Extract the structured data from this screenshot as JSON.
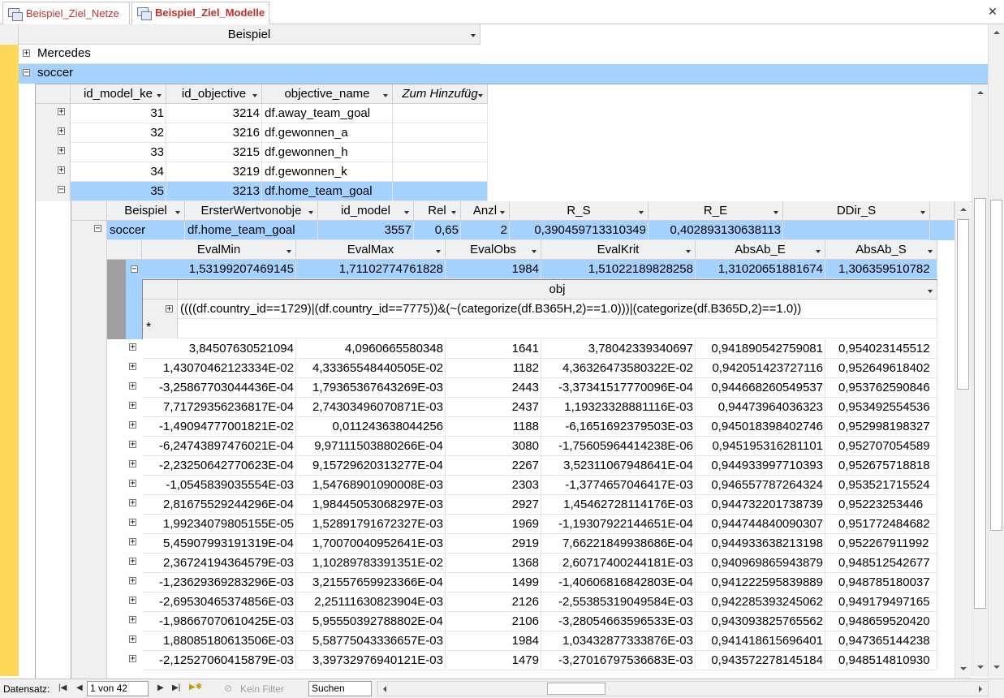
{
  "tabs": [
    {
      "label": "Beispiel_Ziel_Netze",
      "active": false
    },
    {
      "label": "Beispiel_Ziel_Modelle",
      "active": true
    }
  ],
  "close_glyph": "✕",
  "level1": {
    "header": "Beispiel",
    "rows": [
      "Mercedes",
      "soccer"
    ],
    "selected_row": "soccer"
  },
  "level2": {
    "headers": [
      "id_model_ke",
      "id_objective",
      "objective_name",
      "Zum Hinzufüg"
    ],
    "rows": [
      {
        "id_model": "31",
        "id_objective": "3214",
        "objective_name": "df.away_team_goal"
      },
      {
        "id_model": "32",
        "id_objective": "3216",
        "objective_name": "df.gewonnen_a"
      },
      {
        "id_model": "33",
        "id_objective": "3215",
        "objective_name": "df.gewonnen_h"
      },
      {
        "id_model": "34",
        "id_objective": "3219",
        "objective_name": "df.gewonnen_k"
      },
      {
        "id_model": "35",
        "id_objective": "3213",
        "objective_name": "df.home_team_goal"
      }
    ]
  },
  "level3": {
    "headers": [
      "Beispiel",
      "ErsterWertvonobje",
      "id_model",
      "Rel",
      "Anzl",
      "R_S",
      "R_E",
      "DDir_S"
    ],
    "row": {
      "Beispiel": "soccer",
      "ErsterWertvonobje": "df.home_team_goal",
      "id_model": "3557",
      "Rel": "0,65",
      "Anzl": "2",
      "R_S": "0,390459713310349",
      "R_E": "0,402893130638113",
      "DDir_S": ""
    }
  },
  "level4": {
    "headers": [
      "EvalMin",
      "EvalMax",
      "EvalObs",
      "EvalKrit",
      "AbsAb_E",
      "AbsAb_S"
    ],
    "first_row": [
      "1,53199207469145",
      "1,71102774761828",
      "1984",
      "1,51022189828258",
      "1,31020651881674",
      "1,306359510782"
    ],
    "obj_header": "obj",
    "obj_value": "((((df.country_id==1729)|(df.country_id==7775))&(~(categorize(df.B365H,2)==1.0)))|(categorize(df.B365D,2)==1.0))",
    "new_row_marker": "*",
    "rows": [
      [
        "3,84507630521094",
        "4,0960665580348",
        "1641",
        "3,78042339340697",
        "0,941890542759081",
        "0,954023145512"
      ],
      [
        "1,43070462123334E-02",
        "4,33365548440505E-02",
        "1182",
        "4,36326473580322E-02",
        "0,942051423727116",
        "0,952649618402"
      ],
      [
        "-3,25867703044436E-04",
        "1,79365367643269E-03",
        "2443",
        "-3,37341517770096E-04",
        "0,944668260549537",
        "0,953762590846"
      ],
      [
        "7,71729356236817E-04",
        "2,74303496070871E-03",
        "2437",
        "1,19323328881116E-03",
        "0,94473964036323",
        "0,953492554536"
      ],
      [
        "-1,49094777001821E-02",
        "0,011243638044256",
        "1188",
        "-6,1651692379503E-03",
        "0,945018398402746",
        "0,952998198327"
      ],
      [
        "-6,24743897476021E-04",
        "9,97111503880266E-04",
        "3080",
        "-1,75605964414238E-06",
        "0,945195316281101",
        "0,952707054589"
      ],
      [
        "-2,23250642770623E-04",
        "9,15729620313277E-04",
        "2267",
        "3,52311067948641E-04",
        "0,944933997710393",
        "0,952675718818"
      ],
      [
        "-1,0545839035554E-03",
        "1,54768901090008E-03",
        "2303",
        "-1,3774657046417E-03",
        "0,946557787264324",
        "0,953521715524"
      ],
      [
        "2,81675529244296E-04",
        "1,98445053068297E-03",
        "2927",
        "1,45462728114176E-03",
        "0,944732201738739",
        "0,95223253446"
      ],
      [
        "1,99234079805155E-05",
        "1,52891791672327E-03",
        "1969",
        "-1,19307922144651E-04",
        "0,944744840090307",
        "0,951772484682"
      ],
      [
        "5,45907993191319E-04",
        "1,70070040952641E-03",
        "2919",
        "7,66221849938686E-04",
        "0,944933638213198",
        "0,952267911992"
      ],
      [
        "2,36724194364579E-03",
        "1,10289783391351E-02",
        "1368",
        "2,60717400244181E-03",
        "0,940969865943879",
        "0,948512542677"
      ],
      [
        "-1,23629369283296E-03",
        "3,21557659923366E-04",
        "1499",
        "-1,40606816842803E-04",
        "0,941222595839889",
        "0,948785180037"
      ],
      [
        "-2,69530465374856E-03",
        "2,25111630823904E-03",
        "2126",
        "-2,55385319049584E-03",
        "0,942285393245062",
        "0,949179497165"
      ],
      [
        "-1,98667070610425E-03",
        "5,95550392788802E-04",
        "2106",
        "-3,28054663596533E-03",
        "0,943093825765562",
        "0,948659520420"
      ],
      [
        "1,88085180613506E-03",
        "5,58775043336657E-03",
        "1984",
        "1,03432877333876E-03",
        "0,941418615696401",
        "0,947365144238"
      ],
      [
        "-2,12527060415879E-03",
        "3,39732976940121E-03",
        "1479",
        "-3,27016797536683E-03",
        "0,943572278145184",
        "0,948514810930"
      ]
    ]
  },
  "status": {
    "label": "Datensatz:",
    "record": "1 von 42",
    "filter": "Kein Filter",
    "search_placeholder": "Suchen"
  }
}
